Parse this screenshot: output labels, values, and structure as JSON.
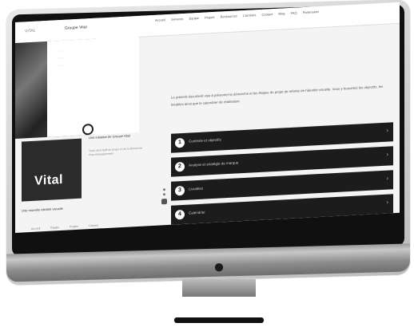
{
  "site": {
    "logo_mini": "VITAL",
    "brand": "Groupe Vital",
    "nav": [
      "Accueil",
      "Services",
      "Équipe",
      "Projets",
      "Ressources",
      "Carrières",
      "Contact",
      "Blog",
      "FAQ",
      "Partenaires"
    ]
  },
  "hero": {
    "lines": [
      "·····",
      "·······",
      "······"
    ]
  },
  "card": {
    "logo_text": "Vital",
    "caption": "Une nouvelle identité visuelle"
  },
  "mid": {
    "title": "Une initiative de Groupe Vital",
    "body": "Texte descriptif du projet et de la démarche d'accompagnement."
  },
  "footer": [
    "Accueil",
    "Équipe",
    "Projets",
    "Contact"
  ],
  "intro": "Le présent document vise à présenter la démarche et les étapes du projet de refonte de l'identité visuelle. Vous y trouverez les objectifs, les livrables ainsi que le calendrier de réalisation.",
  "accordion": [
    {
      "num": "1",
      "label": "Contexte et objectifs"
    },
    {
      "num": "2",
      "label": "Analyse et stratégie de marque"
    },
    {
      "num": "3",
      "label": "Livrables"
    },
    {
      "num": "4",
      "label": "Calendrier"
    }
  ],
  "colors": {
    "accordion_bg": "#1c1c1c",
    "card_bg": "#2b2b2b"
  }
}
